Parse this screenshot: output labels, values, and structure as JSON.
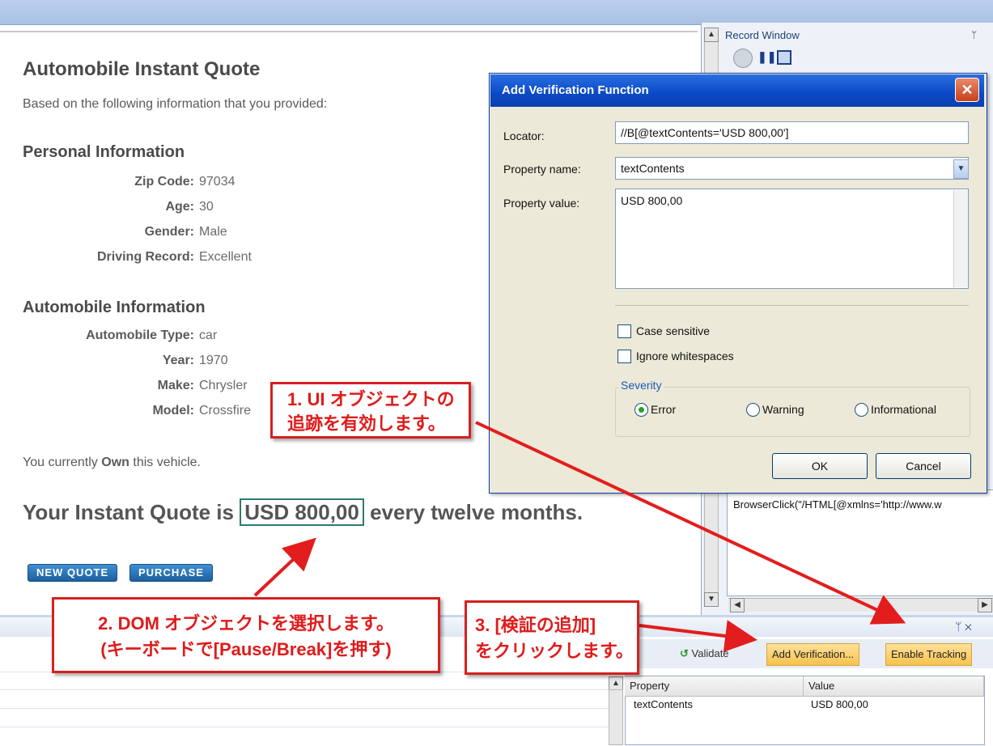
{
  "page": {
    "title": "Automobile Instant Quote",
    "intro": "Based on the following information that you provided:",
    "personal_heading": "Personal Information",
    "personal": [
      {
        "label": "Zip Code:",
        "value": "97034"
      },
      {
        "label": "Age:",
        "value": "30"
      },
      {
        "label": "Gender:",
        "value": "Male"
      },
      {
        "label": "Driving Record:",
        "value": "Excellent"
      }
    ],
    "auto_heading": "Automobile Information",
    "auto": [
      {
        "label": "Automobile Type:",
        "value": "car"
      },
      {
        "label": "Year:",
        "value": "1970"
      },
      {
        "label": "Make:",
        "value": "Chrysler"
      },
      {
        "label": "Model:",
        "value": "Crossfire"
      }
    ],
    "own_prefix": "You currently ",
    "own_bold": "Own",
    "own_suffix": " this vehicle.",
    "quote_prefix": "Your Instant Quote is ",
    "quote_value": "USD 800,00",
    "quote_suffix": " every twelve months.",
    "new_quote_label": "NEW QUOTE",
    "purchase_label": "PURCHASE"
  },
  "record_window": {
    "title": "Record Window",
    "code_line": "BrowserClick(\"/HTML[@xmlns='http://www.w"
  },
  "dialog": {
    "title": "Add Verification Function",
    "locator_label": "Locator:",
    "locator_value": "//B[@textContents='USD 800,00']",
    "property_name_label": "Property name:",
    "property_name_value": "textContents",
    "property_value_label": "Property value:",
    "property_value": "USD 800,00",
    "case_sensitive": "Case sensitive",
    "ignore_whitespace": "Ignore whitespaces",
    "severity_label": "Severity",
    "sev_error": "Error",
    "sev_warning": "Warning",
    "sev_info": "Informational",
    "ok_label": "OK",
    "cancel_label": "Cancel"
  },
  "bottom": {
    "validate_label": "Validate",
    "add_verification_label": "Add Verification...",
    "enable_tracking_label": "Enable Tracking",
    "grid_headers": [
      "Property",
      "Value"
    ],
    "grid_rows": [
      [
        "textContents",
        "USD 800,00"
      ]
    ]
  },
  "callouts": {
    "c1_line1": "1. UI オブジェクトの",
    "c1_line2": "追跡を有効します。",
    "c2_line1": "2. DOM オブジェクトを選択します。",
    "c2_line2": "(キーボードで[Pause/Break]を押す)",
    "c3_line1": "3. [検証の追加]",
    "c3_line2": "をクリックします。"
  }
}
